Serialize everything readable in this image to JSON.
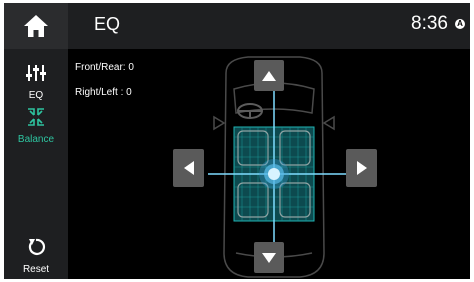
{
  "header": {
    "title": "EQ",
    "time": "8:36",
    "status_badge": "A"
  },
  "sidebar": {
    "items": [
      {
        "label": "EQ",
        "icon": "equalizer-sliders-icon",
        "active": false
      },
      {
        "label": "Balance",
        "icon": "balance-speakers-icon",
        "active": true
      },
      {
        "label": "Reset",
        "icon": "reset-icon",
        "active": false
      }
    ]
  },
  "balance": {
    "front_rear_text": "Front/Rear: 0",
    "right_left_text": "Right/Left : 0",
    "front_rear": 0,
    "right_left": 0
  },
  "colors": {
    "accent": "#3aa0d8",
    "active_green": "#2ec4a0",
    "header_bg": "#1e1f21",
    "arrow_button": "#5a5a5a",
    "seat_grid": "#1fb5b5"
  }
}
